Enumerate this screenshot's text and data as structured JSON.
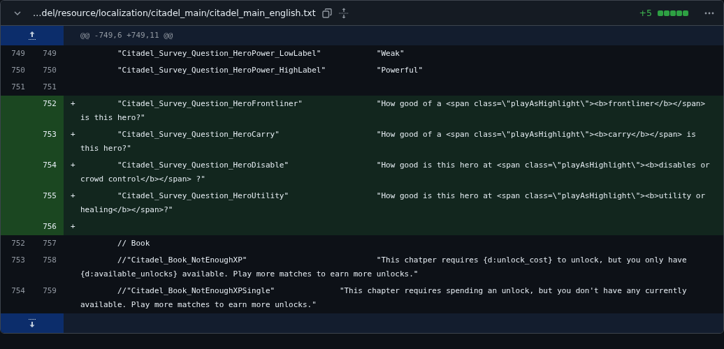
{
  "file_header": {
    "expanded": true,
    "path": "…del/resource/localization/citadel_main/citadel_main_english.txt",
    "additions": "+5",
    "diffstat": [
      {
        "kind": "added"
      },
      {
        "kind": "added"
      },
      {
        "kind": "added"
      },
      {
        "kind": "added"
      },
      {
        "kind": "added"
      }
    ]
  },
  "hunk_header": "@@ -749,6 +749,11 @@",
  "lines": [
    {
      "kind": "context",
      "old": "749",
      "new": "749",
      "code": "\t\t\"Citadel_Survey_Question_HeroPower_LowLabel\"\t\t\t\"Weak\""
    },
    {
      "kind": "context",
      "old": "750",
      "new": "750",
      "code": "\t\t\"Citadel_Survey_Question_HeroPower_HighLabel\"\t\t\t\"Powerful\""
    },
    {
      "kind": "context",
      "old": "751",
      "new": "751"
    },
    {
      "kind": "added",
      "new": "752",
      "marker": "+",
      "code": "\t\t\"Citadel_Survey_Question_HeroFrontliner\"\t\t\t\t\"How good of a <span class=\\\"playAsHighlight\\\"><b>frontliner</b></span> is this hero?\""
    },
    {
      "kind": "added",
      "new": "753",
      "marker": "+",
      "code": "\t\t\"Citadel_Survey_Question_HeroCarry\"\t\t\t\t\t\t\"How good of a <span class=\\\"playAsHighlight\\\"><b>carry</b></span> is this hero?\""
    },
    {
      "kind": "added",
      "new": "754",
      "marker": "+",
      "code": "\t\t\"Citadel_Survey_Question_HeroDisable\"\t\t\t\t\t\"How good is this hero at <span class=\\\"playAsHighlight\\\"><b>disables or crowd control</b></span> ?\""
    },
    {
      "kind": "added",
      "new": "755",
      "marker": "+",
      "code": "\t\t\"Citadel_Survey_Question_HeroUtility\"\t\t\t\t\t\"How good is this hero at <span class=\\\"playAsHighlight\\\"><b>utility or healing</b></span>?\""
    },
    {
      "kind": "added",
      "new": "756",
      "marker": "+"
    },
    {
      "kind": "context",
      "old": "752",
      "new": "757",
      "code": "\t\t// Book"
    },
    {
      "kind": "context",
      "old": "753",
      "new": "758",
      "code": "\t\t//\"Citadel_Book_NotEnoughXP\"\t\t\t\t\t\t\t\"This chatper requires {d:unlock_cost} to unlock, but you only have {d:available_unlocks} available. Play more matches to earn more unlocks.\""
    },
    {
      "kind": "context",
      "old": "754",
      "new": "759",
      "code": "\t\t//\"Citadel_Book_NotEnoughXPSingle\"\t\t\t\t\"This chapter requires spending an unlock, but you don't have any currently available. Play more matches to earn more unlocks.\""
    }
  ]
}
